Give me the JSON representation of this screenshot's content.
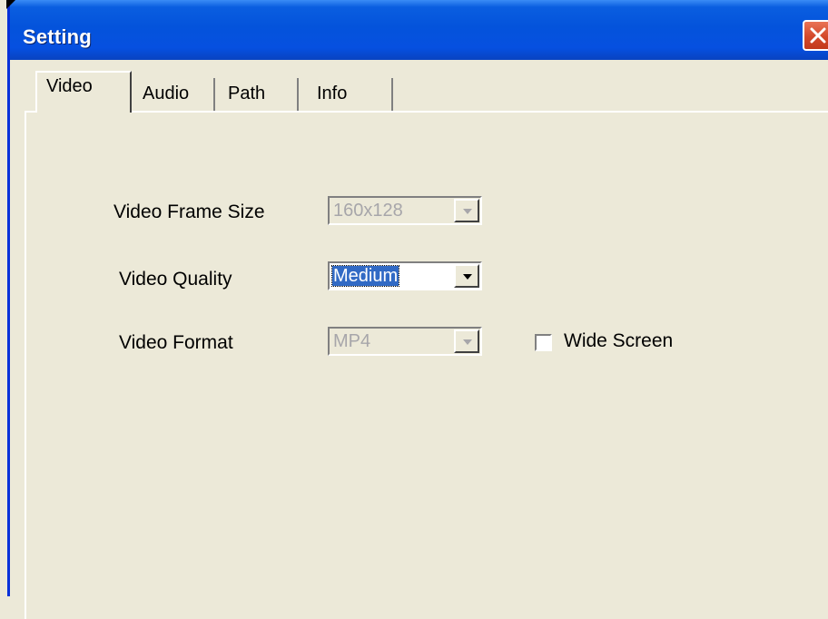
{
  "window": {
    "title": "Setting"
  },
  "tabs": [
    {
      "label": "Video",
      "selected": true
    },
    {
      "label": "Audio",
      "selected": false
    },
    {
      "label": "Path",
      "selected": false
    },
    {
      "label": "Info",
      "selected": false
    }
  ],
  "video": {
    "frame_size_label": "Video Frame Size",
    "frame_size_value": "160x128",
    "frame_size_enabled": false,
    "quality_label": "Video Quality",
    "quality_value": "Medium",
    "quality_enabled": true,
    "format_label": "Video Format",
    "format_value": "MP4",
    "format_enabled": false,
    "wide_screen_label": "Wide Screen",
    "wide_screen_checked": false
  },
  "icons": {
    "close": "close-icon",
    "dropdown": "chevron-down-icon"
  },
  "colors": {
    "titlebar": "#0453db",
    "close_button": "#d3482a",
    "dialog_background": "#ece9d8",
    "selection_highlight": "#316ac5",
    "disabled_text": "#a7a6aa"
  }
}
